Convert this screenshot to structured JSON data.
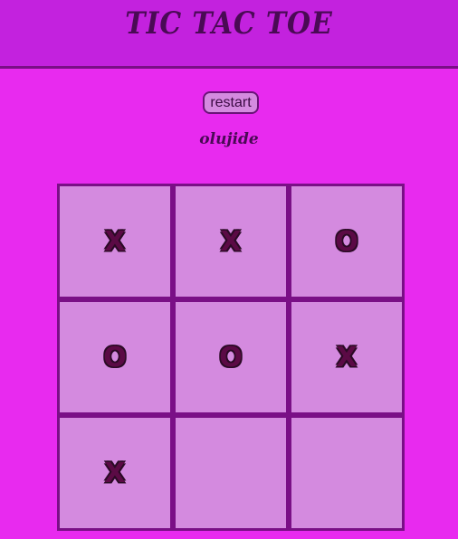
{
  "header": {
    "title": "TIC TAC TOE"
  },
  "controls": {
    "restart_label": "restart"
  },
  "status": {
    "current_player": "olujide"
  },
  "board": {
    "cells": [
      "X",
      "X",
      "O",
      "O",
      "O",
      "X",
      "X",
      "",
      ""
    ]
  },
  "colors": {
    "page_background": "#e82aef",
    "header_background": "#c322de",
    "board_grid": "#7a0f86",
    "cell_background": "#d48adf",
    "mark_color": "#5b0a45"
  }
}
